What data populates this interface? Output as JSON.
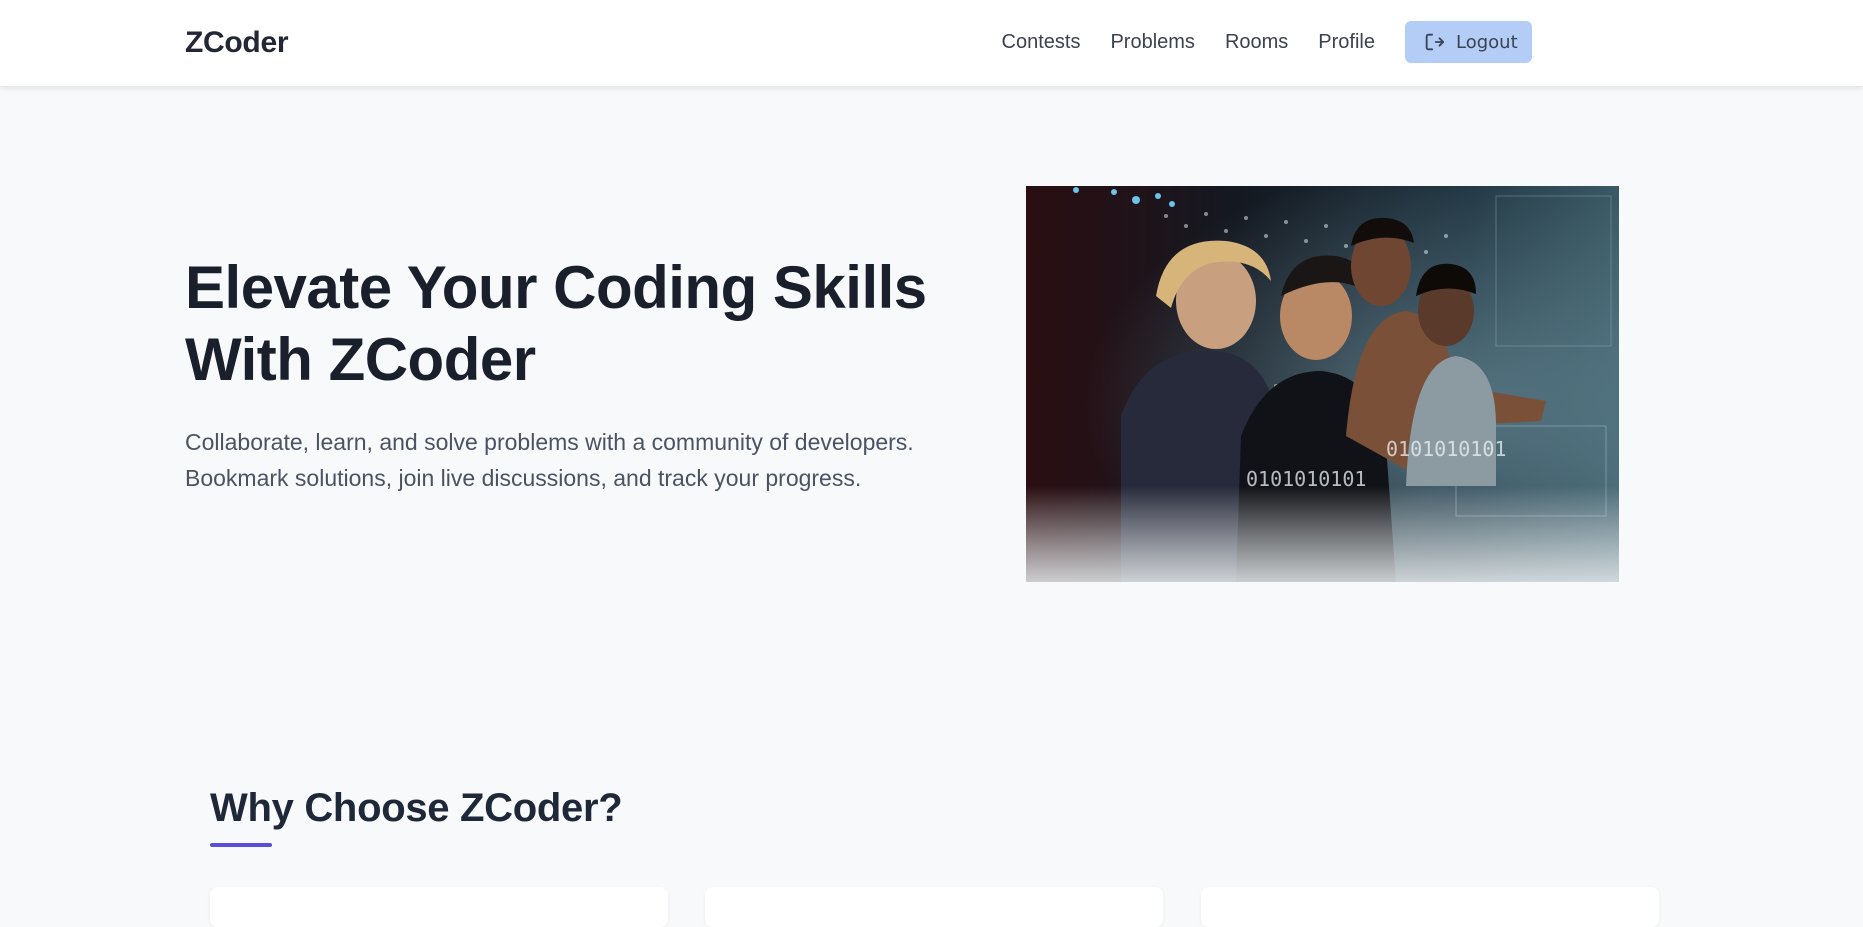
{
  "navbar": {
    "brand": "ZCoder",
    "links": [
      {
        "label": "Contests"
      },
      {
        "label": "Problems"
      },
      {
        "label": "Rooms"
      },
      {
        "label": "Profile"
      }
    ],
    "logout_label": "Logout",
    "logout_icon": "logout-icon",
    "accent_color": "#b3cdf6"
  },
  "hero": {
    "title": "Elevate Your Coding Skills With ZCoder",
    "subtitle": "Collaborate, learn, and solve problems with a community of developers. Bookmark solutions, join live discussions, and track your progress.",
    "image_description": "developers-looking-at-screen-photo"
  },
  "why": {
    "title": "Why Choose ZCoder?",
    "underline_color": "#5b4ed6"
  }
}
